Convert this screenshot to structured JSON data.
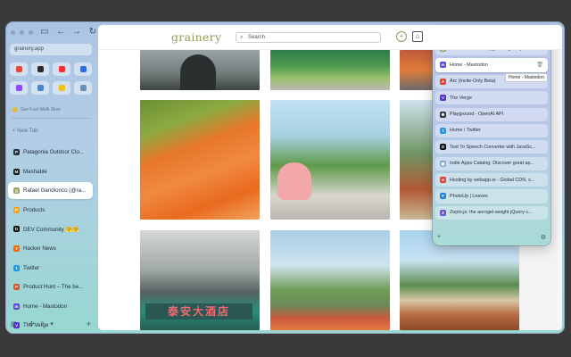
{
  "sidebar": {
    "url": "grainery.app",
    "favorites": [
      {
        "icon": "gmail-icon",
        "color": "#e24b3b"
      },
      {
        "icon": "notion-icon",
        "color": "#2b2b2b"
      },
      {
        "icon": "youtube-icon",
        "color": "#ff2d2d"
      },
      {
        "icon": "facebook-icon",
        "color": "#2f6ee0"
      },
      {
        "icon": "messenger-icon",
        "color": "#8a4dff"
      },
      {
        "icon": "screen-icon",
        "color": "#4a86c7"
      },
      {
        "icon": "bulb-icon",
        "color": "#f0c21d"
      },
      {
        "icon": "puzzle-icon",
        "color": "#6e8fb5"
      }
    ],
    "fast_walk": "See Fast Walk Slow",
    "new_tab": "+ New Tab",
    "tabs": [
      {
        "label": "Patagonia Outdoor Clo...",
        "icon": "patagonia-icon",
        "color": "#23303d",
        "glyph": "P"
      },
      {
        "label": "Mashable",
        "icon": "mashable-icon",
        "color": "#1c1c1c",
        "glyph": "M"
      },
      {
        "label": "Rafael Gandionco (@ra...",
        "icon": "grainery-icon",
        "color": "#9aa36a",
        "glyph": "g",
        "active": true
      },
      {
        "label": "Products",
        "icon": "products-icon",
        "color": "#f2a020",
        "glyph": "P"
      },
      {
        "label": "DEV Community 🤗🤗",
        "icon": "dev-icon",
        "color": "#111111",
        "glyph": "D"
      },
      {
        "label": "Hacker News",
        "icon": "hackernews-icon",
        "color": "#ff6600",
        "glyph": "Y"
      },
      {
        "label": "Twitter",
        "icon": "twitter-icon",
        "color": "#1d9bf0",
        "glyph": "t"
      },
      {
        "label": "Product Hunt – The be...",
        "icon": "producthunt-icon",
        "color": "#da552f",
        "glyph": "P"
      },
      {
        "label": "Home - Mastodon",
        "icon": "mastodon-icon",
        "color": "#5b4ae0",
        "glyph": "m"
      },
      {
        "label": "The Verge",
        "icon": "verge-icon",
        "color": "#5a2bd6",
        "glyph": "V"
      }
    ]
  },
  "main": {
    "logo": "grainery",
    "search_placeholder": "Search",
    "sign_text": "泰安大酒店"
  },
  "switcher": {
    "items": [
      {
        "label": "Rafael Gandionco (@rafaelgandi) - Gr...",
        "icon": "grainery-icon",
        "color": "#9aa36a",
        "glyph": "g"
      },
      {
        "label": "Home - Mastodon",
        "icon": "mastodon-icon",
        "color": "#5b4ae0",
        "glyph": "m",
        "selected": true
      },
      {
        "label": "Arc (Invite-Only Beta)",
        "icon": "arc-icon",
        "color": "#e8402e",
        "glyph": "A"
      },
      {
        "label": "The Verge",
        "icon": "verge-icon",
        "color": "#5a2bd6",
        "glyph": "V"
      },
      {
        "label": "Playground - OpenAI API",
        "icon": "openai-icon",
        "color": "#333333",
        "glyph": "✺"
      },
      {
        "label": "Home / Twitter",
        "icon": "twitter-icon",
        "color": "#1d9bf0",
        "glyph": "t"
      },
      {
        "label": "Text To Speech Converter with JavaSc...",
        "icon": "dev-icon",
        "color": "#111111",
        "glyph": "D"
      },
      {
        "label": "Indie Apps Catalog: Discover great ap...",
        "icon": "indieapps-icon",
        "color": "#7aa6d8",
        "glyph": "▦"
      },
      {
        "label": "Hosting by webapp.io - Global CDN, s...",
        "icon": "webapp-icon",
        "color": "#e8402e",
        "glyph": "w"
      },
      {
        "label": "PhotoUp | Leaves",
        "icon": "photoup-icon",
        "color": "#2b7fe0",
        "glyph": "P"
      },
      {
        "label": "Zepto.js: the aerogel-weight jQuery-c...",
        "icon": "zepto-icon",
        "color": "#6a55d8",
        "glyph": "Z"
      }
    ],
    "tooltip": "Home - Mastodon"
  }
}
